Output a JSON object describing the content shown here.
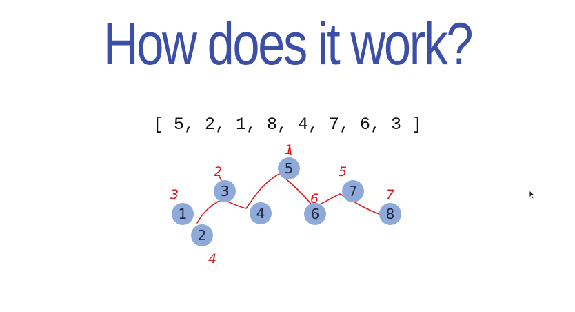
{
  "slide": {
    "title": "How does it work?",
    "array_text": "[ 5, 2, 1, 8, 4, 7, 6, 3 ]"
  },
  "diagram": {
    "nodes": [
      {
        "label": "1"
      },
      {
        "label": "2"
      },
      {
        "label": "3"
      },
      {
        "label": "4"
      },
      {
        "label": "5"
      },
      {
        "label": "6"
      },
      {
        "label": "7"
      },
      {
        "label": "8"
      }
    ],
    "annotations": [
      {
        "text": "3"
      },
      {
        "text": "2"
      },
      {
        "text": "4"
      },
      {
        "text": "1"
      },
      {
        "text": "6"
      },
      {
        "text": "5"
      },
      {
        "text": "7"
      }
    ],
    "colors": {
      "node_fill": "#8fa9d8",
      "ink": "#e0191e",
      "title": "#3b4fa8"
    }
  }
}
